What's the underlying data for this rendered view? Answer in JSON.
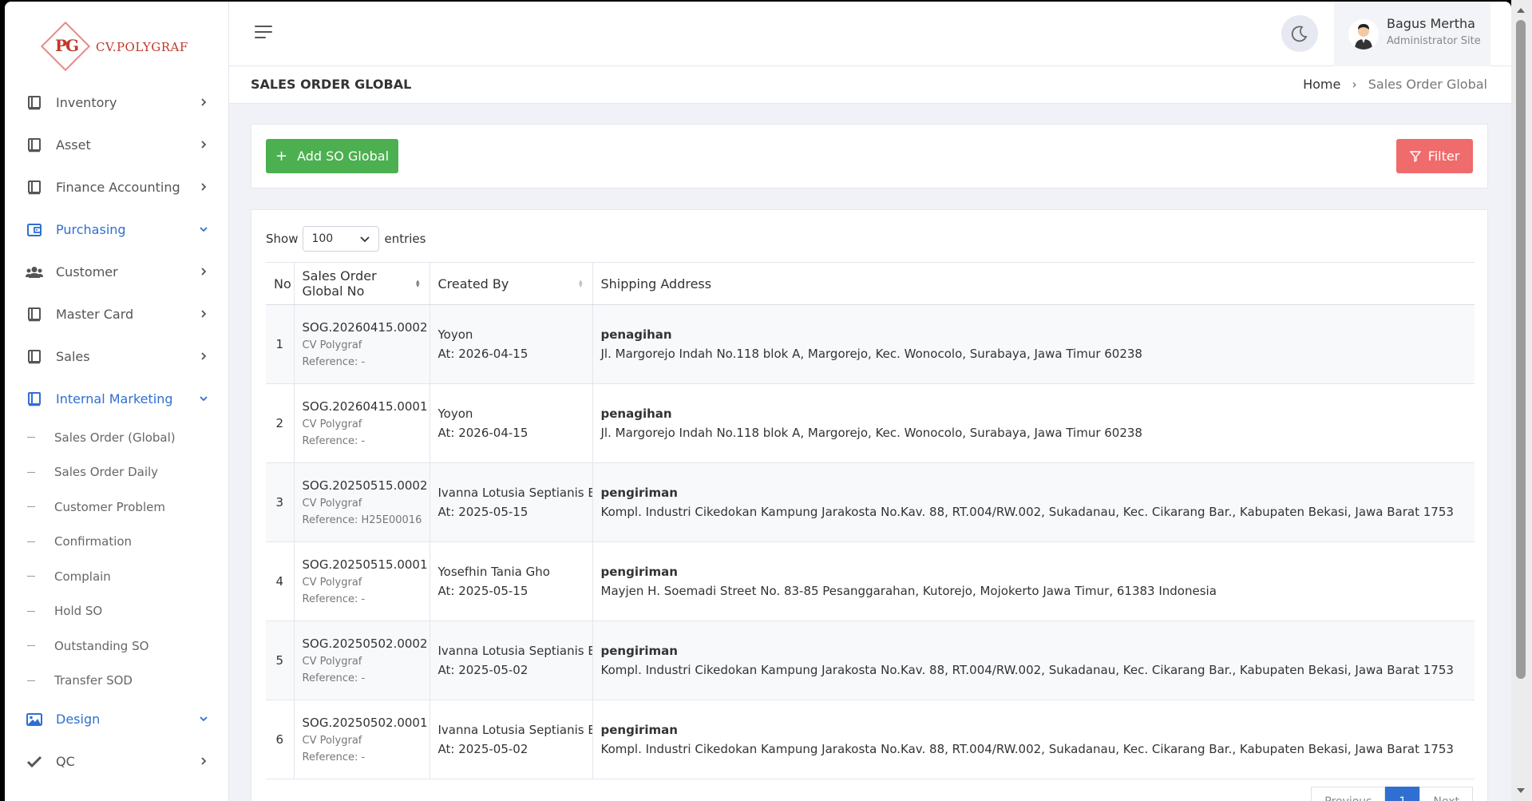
{
  "logo": {
    "mark": "PG",
    "text": "CV.POLYGRAF"
  },
  "sidebar": {
    "items": [
      {
        "label": "Inventory",
        "icon": "book-icon",
        "expanded": false
      },
      {
        "label": "Asset",
        "icon": "book-icon",
        "expanded": false
      },
      {
        "label": "Finance Accounting",
        "icon": "book-icon",
        "expanded": false
      },
      {
        "label": "Purchasing",
        "icon": "wallet-icon",
        "expanded": true
      },
      {
        "label": "Customer",
        "icon": "users-icon",
        "expanded": false
      },
      {
        "label": "Master Card",
        "icon": "book-icon",
        "expanded": false
      },
      {
        "label": "Sales",
        "icon": "book-icon",
        "expanded": false
      },
      {
        "label": "Internal Marketing",
        "icon": "book-icon",
        "expanded": true
      }
    ],
    "sub_items": [
      {
        "label": "Sales Order (Global)"
      },
      {
        "label": "Sales Order Daily"
      },
      {
        "label": "Customer Problem"
      },
      {
        "label": "Confirmation"
      },
      {
        "label": "Complain"
      },
      {
        "label": "Hold SO"
      },
      {
        "label": "Outstanding SO"
      },
      {
        "label": "Transfer SOD"
      }
    ],
    "bottom_items": [
      {
        "label": "Design",
        "icon": "image-icon",
        "expanded": true
      },
      {
        "label": "QC",
        "icon": "check-icon",
        "expanded": false
      }
    ]
  },
  "user": {
    "name": "Bagus Mertha",
    "role": "Administrator Site"
  },
  "page": {
    "title": "SALES ORDER GLOBAL"
  },
  "breadcrumb": {
    "home": "Home",
    "current": "Sales Order Global"
  },
  "actions": {
    "add_label": "Add SO Global",
    "filter_label": "Filter"
  },
  "entries": {
    "show": "Show",
    "value": "100",
    "suffix": "entries"
  },
  "table": {
    "columns": [
      "No",
      "Sales Order Global No",
      "Created By",
      "Shipping Address"
    ],
    "rows": [
      {
        "no": "1",
        "so_no": "SOG.20260415.0002",
        "company": "CV Polygraf",
        "reference": "Reference: -",
        "created_by": "Yoyon",
        "created_at": "At: 2026-04-15",
        "addr_type": "penagihan",
        "address": "Jl. Margorejo Indah No.118 blok A, Margorejo, Kec. Wonocolo, Surabaya, Jawa Timur 60238"
      },
      {
        "no": "2",
        "so_no": "SOG.20260415.0001",
        "company": "CV Polygraf",
        "reference": "Reference: -",
        "created_by": "Yoyon",
        "created_at": "At: 2026-04-15",
        "addr_type": "penagihan",
        "address": "Jl. Margorejo Indah No.118 blok A, Margorejo, Kec. Wonocolo, Surabaya, Jawa Timur 60238"
      },
      {
        "no": "3",
        "so_no": "SOG.20250515.0002",
        "company": "CV Polygraf",
        "reference": "Reference: H25E00016",
        "created_by": "Ivanna Lotusia Septianis Bintoro",
        "created_at": "At: 2025-05-15",
        "addr_type": "pengiriman",
        "address": "Kompl. Industri Cikedokan Kampung Jarakosta No.Kav. 88, RT.004/RW.002, Sukadanau, Kec. Cikarang Bar., Kabupaten Bekasi, Jawa Barat 1753"
      },
      {
        "no": "4",
        "so_no": "SOG.20250515.0001",
        "company": "CV Polygraf",
        "reference": "Reference: -",
        "created_by": "Yosefhin Tania Gho",
        "created_at": "At: 2025-05-15",
        "addr_type": "pengiriman",
        "address": "Mayjen H. Soemadi Street No. 83-85 Pesanggarahan, Kutorejo, Mojokerto Jawa Timur, 61383 Indonesia"
      },
      {
        "no": "5",
        "so_no": "SOG.20250502.0002",
        "company": "CV Polygraf",
        "reference": "Reference: -",
        "created_by": "Ivanna Lotusia Septianis Bintoro",
        "created_at": "At: 2025-05-02",
        "addr_type": "pengiriman",
        "address": "Kompl. Industri Cikedokan Kampung Jarakosta No.Kav. 88, RT.004/RW.002, Sukadanau, Kec. Cikarang Bar., Kabupaten Bekasi, Jawa Barat 1753"
      },
      {
        "no": "6",
        "so_no": "SOG.20250502.0001",
        "company": "CV Polygraf",
        "reference": "Reference: -",
        "created_by": "Ivanna Lotusia Septianis Bintoro",
        "created_at": "At: 2025-05-02",
        "addr_type": "pengiriman",
        "address": "Kompl. Industri Cikedokan Kampung Jarakosta No.Kav. 88, RT.004/RW.002, Sukadanau, Kec. Cikarang Bar., Kabupaten Bekasi, Jawa Barat 1753"
      }
    ]
  },
  "pagination": {
    "previous": "Previous",
    "current": "1",
    "next": "Next"
  },
  "colors": {
    "accent": "#2f6fd1",
    "add_button": "#4caf50",
    "filter_button": "#f06b6b"
  }
}
